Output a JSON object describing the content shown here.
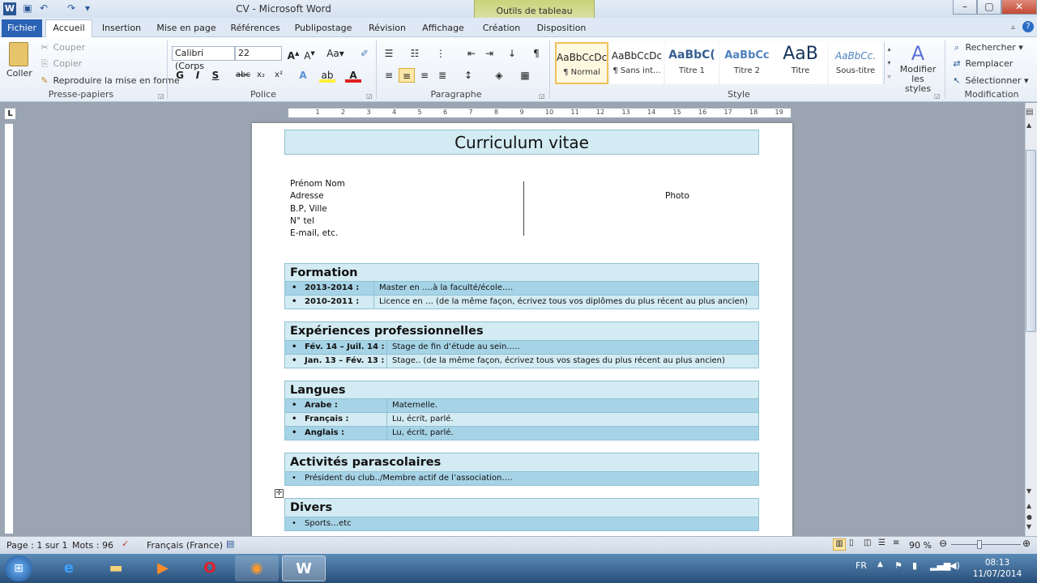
{
  "window": {
    "title": "CV  -  Microsoft Word",
    "context_tab_group": "Outils de tableau"
  },
  "tabs": [
    "Fichier",
    "Accueil",
    "Insertion",
    "Mise en page",
    "Références",
    "Publipostage",
    "Révision",
    "Affichage",
    "Création",
    "Disposition"
  ],
  "ribbon": {
    "clipboard": {
      "paste": "Coller",
      "cut": "Couper",
      "copy": "Copier",
      "format_painter": "Reproduire la mise en forme",
      "label": "Presse-papiers"
    },
    "font": {
      "name": "Calibri (Corps",
      "size": "22",
      "label": "Police"
    },
    "paragraph": {
      "label": "Paragraphe"
    },
    "styles": {
      "label": "Style",
      "items": [
        {
          "sample": "AaBbCcDc",
          "name": "¶ Normal"
        },
        {
          "sample": "AaBbCcDc",
          "name": "¶ Sans int..."
        },
        {
          "sample": "AaBbC(",
          "name": "Titre 1"
        },
        {
          "sample": "AaBbCc",
          "name": "Titre 2"
        },
        {
          "sample": "AaB",
          "name": "Titre"
        },
        {
          "sample": "AaBbCc.",
          "name": "Sous-titre"
        }
      ],
      "modify": "Modifier les styles"
    },
    "editing": {
      "find": "Rechercher",
      "replace": "Remplacer",
      "select": "Sélectionner",
      "label": "Modification"
    }
  },
  "document": {
    "title": "Curriculum vitae",
    "contact": [
      "Prénom Nom",
      "Adresse",
      "B.P, Ville",
      "N° tel",
      "E-mail,  etc."
    ],
    "photo": "Photo",
    "sections": [
      {
        "heading": "Formation",
        "rows": [
          {
            "k": "2013-2014 :",
            "v": "Master en ….à la faculté/école…."
          },
          {
            "k": "2010-2011 :",
            "v": "Licence en … (de la même façon, écrivez tous vos diplômes du plus récent au plus ancien)"
          }
        ]
      },
      {
        "heading": "Expériences professionnelles",
        "rows": [
          {
            "k": "Fév. 14 – Juil. 14 :",
            "v": "Stage de fin d’étude au sein….."
          },
          {
            "k": "Jan. 13 – Fév. 13 :",
            "v": "Stage.. (de la même façon, écrivez tous vos stages du plus récent au plus ancien)"
          }
        ]
      },
      {
        "heading": "Langues",
        "rows": [
          {
            "k": "Arabe :",
            "v": "Maternelle."
          },
          {
            "k": "Français  :",
            "v": "Lu, écrit, parlé."
          },
          {
            "k": "Anglais :",
            "v": "Lu, écrit, parlé."
          }
        ]
      },
      {
        "heading": "Activités parascolaires",
        "rows": [
          {
            "k": "",
            "v": "Président du club../Membre actif de l’association…."
          }
        ]
      },
      {
        "heading": "Divers",
        "rows": [
          {
            "k": "",
            "v": "Sports…etc"
          }
        ]
      }
    ]
  },
  "status": {
    "page": "Page : 1 sur 1",
    "words": "Mots : 96",
    "language": "Français (France)",
    "zoom": "90 %"
  },
  "clock": {
    "time": "08:13",
    "date": "11/07/2014"
  },
  "tray": {
    "lang": "FR"
  }
}
